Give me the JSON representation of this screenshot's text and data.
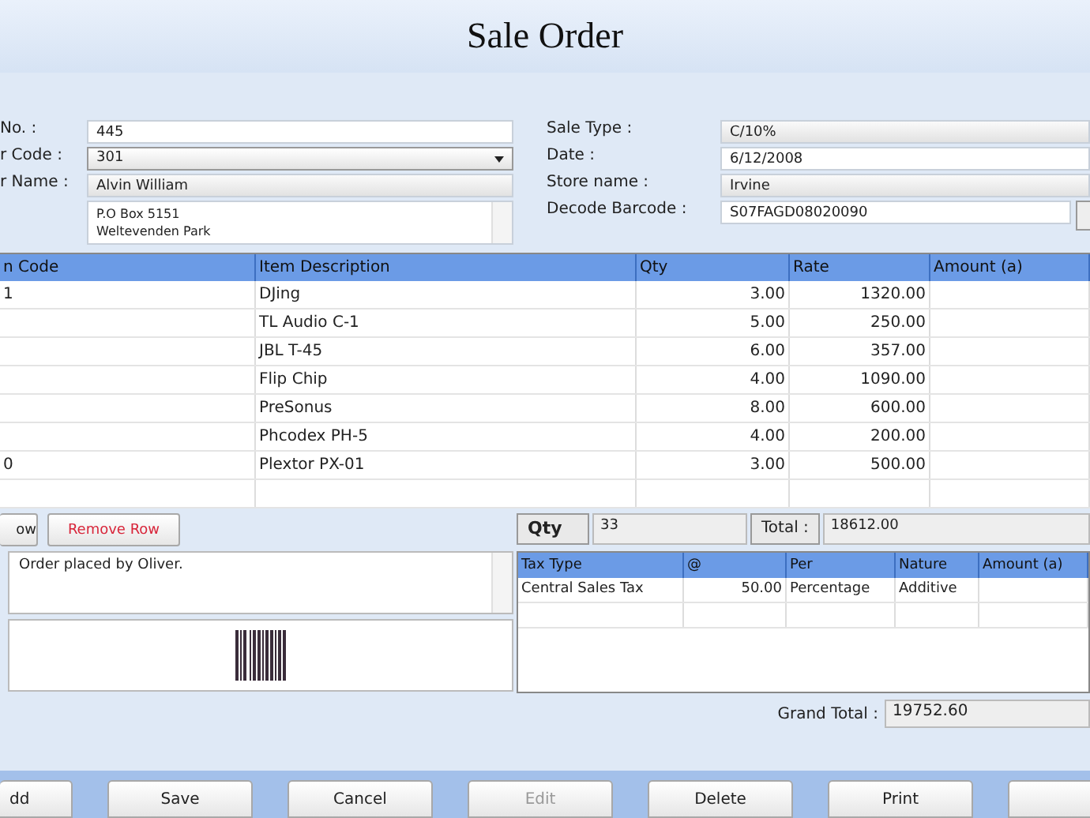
{
  "window": {
    "title": "Sale Order"
  },
  "form_left": [
    {
      "label": "No. :",
      "value": "445",
      "kind": "text"
    },
    {
      "label": "r Code :",
      "value": "301",
      "kind": "dropdown"
    },
    {
      "label": "r Name :",
      "value": "Alvin William",
      "kind": "readonly"
    },
    {
      "value": "P.O Box 5151\nWeltevenden Park",
      "kind": "memo"
    }
  ],
  "form_right": [
    {
      "label": "Sale Type :",
      "value": "C/10%",
      "kind": "readonly"
    },
    {
      "label": "Date :",
      "value": "6/12/2008",
      "kind": "text"
    },
    {
      "label": "Store name :",
      "value": "Irvine",
      "kind": "readonly"
    },
    {
      "label": "Decode Barcode :",
      "value": "S07FAGD08020090",
      "kind": "barcode"
    }
  ],
  "items_table": {
    "columns": [
      "n Code",
      "Item Description",
      "Qty",
      "Rate",
      "Amount (a)"
    ],
    "rows": [
      [
        "1",
        "DJing",
        "3.00",
        "1320.00",
        ""
      ],
      [
        "",
        "TL Audio C-1",
        "5.00",
        "250.00",
        ""
      ],
      [
        "",
        "JBL T-45",
        "6.00",
        "357.00",
        ""
      ],
      [
        "",
        "Flip Chip",
        "4.00",
        "1090.00",
        ""
      ],
      [
        "",
        "PreSonus",
        "8.00",
        "600.00",
        ""
      ],
      [
        "",
        "Phcodex PH-5",
        "4.00",
        "200.00",
        ""
      ],
      [
        "0",
        "Plextor PX-01",
        "3.00",
        "500.00",
        ""
      ]
    ]
  },
  "row_buttons": [
    {
      "label": "ow",
      "kind": "normal"
    },
    {
      "label": "Remove Row",
      "kind": "danger"
    }
  ],
  "summary": {
    "qty_label": "Qty",
    "qty": "33",
    "total_label": "Total :",
    "total": "18612.00"
  },
  "notes": "Order placed by Oliver.",
  "tax_table": {
    "columns": [
      "Tax Type",
      "@",
      "Per",
      "Nature",
      "Amount (a)"
    ],
    "rows": [
      [
        "Central Sales Tax",
        "50.00",
        "Percentage",
        "Additive",
        ""
      ]
    ]
  },
  "grand_total": {
    "label": "Grand Total :",
    "value": "19752.60"
  },
  "buttons": [
    {
      "label": "dd",
      "disabled": false
    },
    {
      "label": "Save",
      "disabled": false
    },
    {
      "label": "Cancel",
      "disabled": false
    },
    {
      "label": "Edit",
      "disabled": true
    },
    {
      "label": "Delete",
      "disabled": false
    },
    {
      "label": "Print",
      "disabled": false
    }
  ]
}
